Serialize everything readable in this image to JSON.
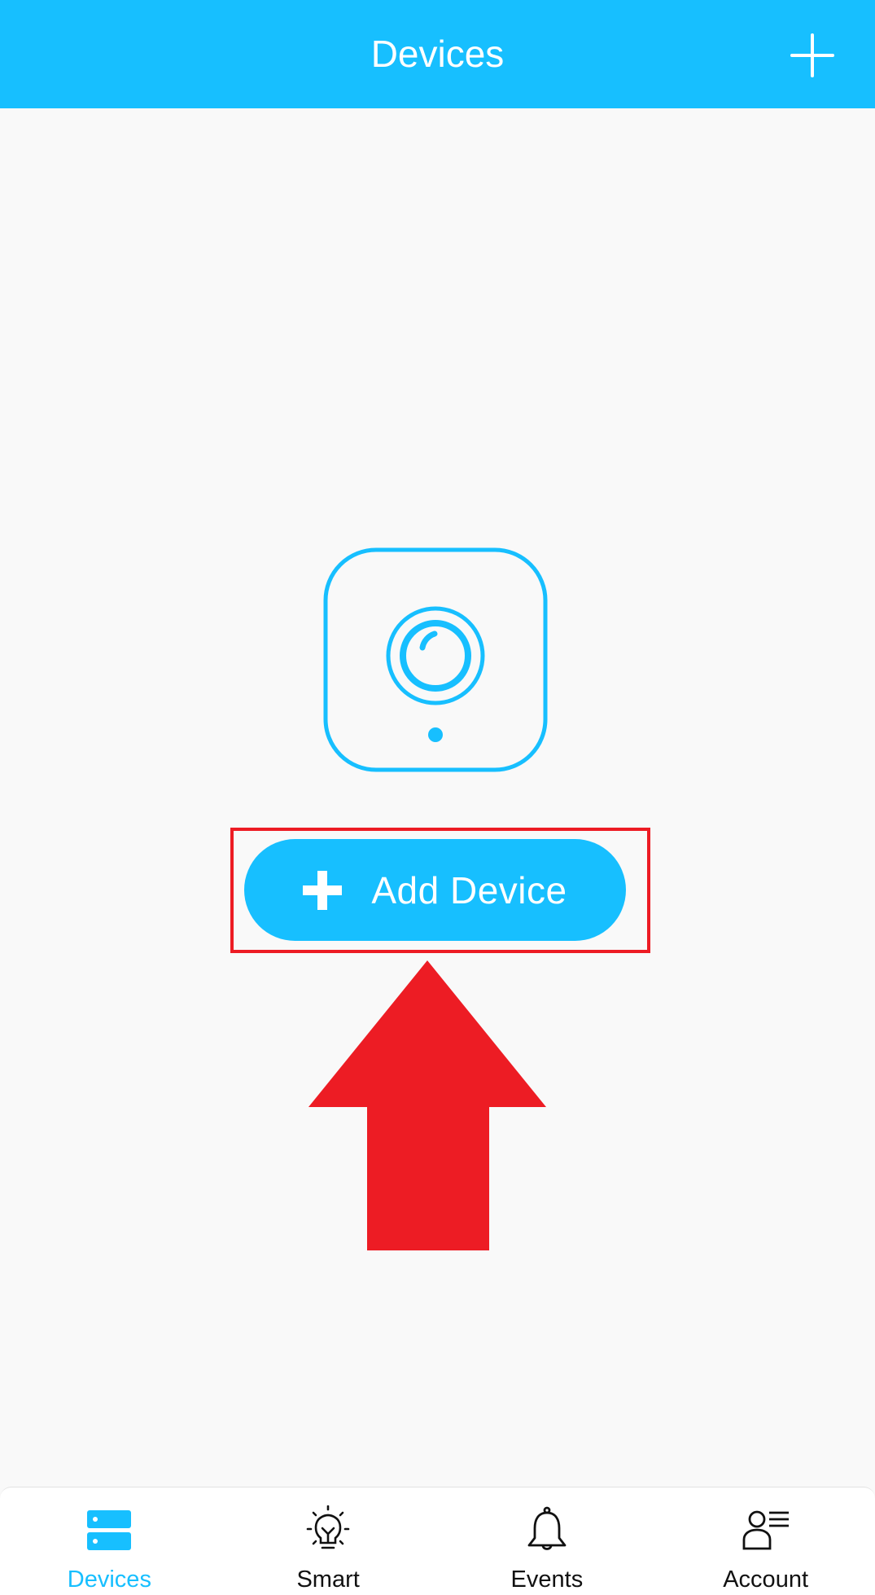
{
  "header": {
    "title": "Devices",
    "add_icon": "plus-icon"
  },
  "empty_state": {
    "icon": "camera-icon",
    "add_button": {
      "icon": "plus-icon",
      "label": "Add Device"
    }
  },
  "annotation": {
    "highlight": "red-box-around-add-device",
    "pointer": "red-up-arrow",
    "color": "#ed1c24"
  },
  "bottom_nav": {
    "items": [
      {
        "label": "Devices",
        "icon": "devices-icon",
        "active": true
      },
      {
        "label": "Smart",
        "icon": "lightbulb-icon",
        "active": false
      },
      {
        "label": "Events",
        "icon": "bell-icon",
        "active": false
      },
      {
        "label": "Account",
        "icon": "account-icon",
        "active": false
      }
    ]
  },
  "colors": {
    "accent": "#17bfff",
    "background": "#f9f9f9",
    "annotation": "#ed1c24"
  }
}
